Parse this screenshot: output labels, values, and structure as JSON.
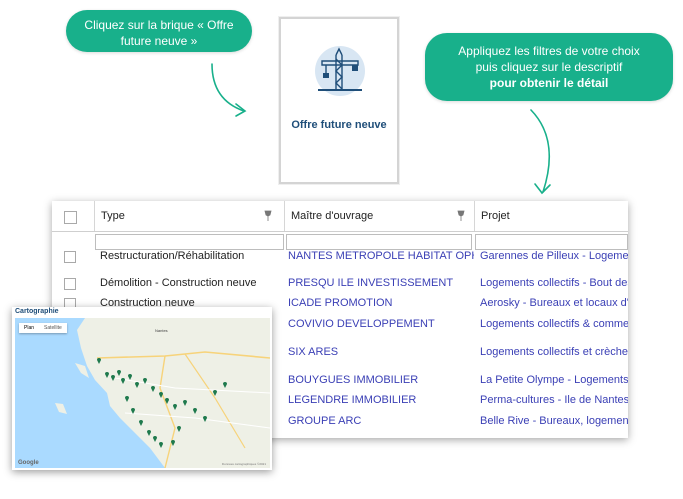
{
  "callouts": {
    "brick_line1": "Cliquez sur la brique « Offre",
    "brick_line2": "future neuve »",
    "filters_line1": "Appliquez les filtres de votre choix",
    "filters_line2": "puis cliquez sur le descriptif",
    "filters_line3": "pour obtenir le détail"
  },
  "card": {
    "label": "Offre future neuve",
    "icon": "crane-icon"
  },
  "table": {
    "headers": [
      "Type",
      "Maître d'ouvrage",
      "Projet"
    ],
    "rows": [
      {
        "type": "Restructuration/Réhabilitation",
        "mo": "NANTES METROPOLE HABITAT OPH",
        "projet": "Garennes de Pilleux - Logements"
      },
      {
        "type": "Démolition - Construction neuve",
        "mo": "PRESQU ILE INVESTISSEMENT",
        "projet": "Logements collectifs - Bout des"
      },
      {
        "type": "Construction neuve",
        "mo": "ICADE PROMOTION",
        "projet": "Aerosky - Bureaux et locaux d'ac"
      },
      {
        "type": "",
        "mo": "COVIVIO DEVELOPPEMENT",
        "projet": "Logements collectifs & commer"
      },
      {
        "type": "",
        "mo": "SIX ARES",
        "projet": "Logements collectifs et crèche -"
      },
      {
        "type": "",
        "mo": "BOUYGUES IMMOBILIER",
        "projet": "La Petite Olympe - Logements c"
      },
      {
        "type": "",
        "mo": "LEGENDRE IMMOBILIER",
        "projet": "Perma-cultures - Ile de Nantes -"
      },
      {
        "type": "",
        "mo": "GROUPE ARC",
        "projet": "Belle Rive - Bureaux, logements"
      }
    ]
  },
  "map": {
    "title": "Cartographie",
    "tab_plan": "Plan",
    "tab_satellite": "Satellite",
    "city": "Nantes",
    "logo": "Google",
    "copyright": "Données cartographiques ©2021"
  },
  "colors": {
    "bubble": "#18b08b",
    "link": "#3a3fb5",
    "card_label": "#1f4e79"
  }
}
